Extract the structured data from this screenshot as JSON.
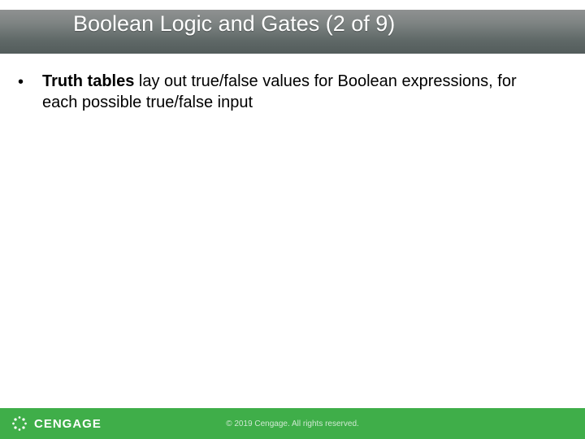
{
  "title": "Boolean Logic and Gates (2 of 9)",
  "bullets": [
    {
      "bold": "Truth tables",
      "rest": " lay out true/false values for Boolean expressions, for each possible true/false input"
    }
  ],
  "footer": {
    "brand": "CENGAGE",
    "copyright": "© 2019 Cengage. All rights reserved."
  }
}
